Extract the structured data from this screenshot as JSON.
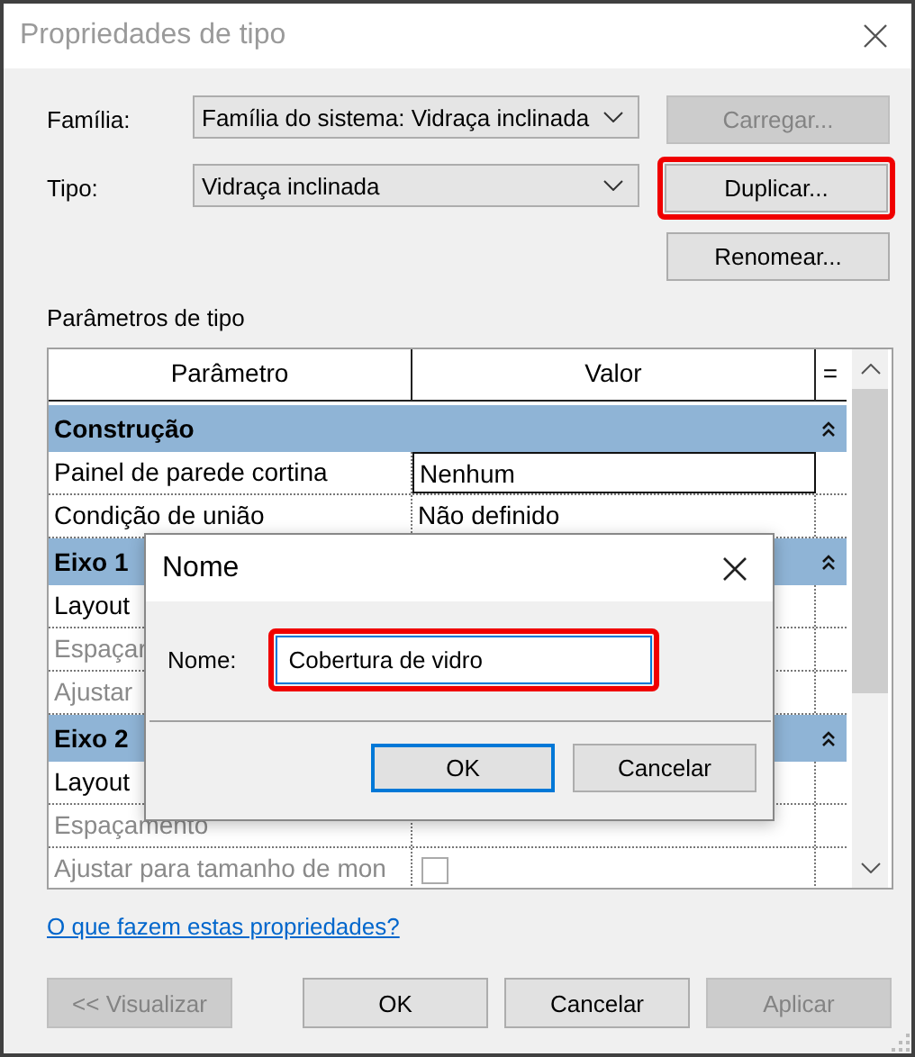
{
  "window": {
    "title": "Propriedades de tipo"
  },
  "selectors": [
    {
      "label": "Família:",
      "value": "Família do sistema: Vidraça inclinada"
    },
    {
      "label": "Tipo:",
      "value": "Vidraça inclinada"
    }
  ],
  "side_buttons": [
    {
      "label": "Carregar...",
      "disabled": true,
      "highlighted": false
    },
    {
      "label": "Duplicar...",
      "disabled": false,
      "highlighted": true
    },
    {
      "label": "Renomear...",
      "disabled": false,
      "highlighted": false
    }
  ],
  "parameters": {
    "label": "Parâmetros de tipo",
    "columns": [
      "Parâmetro",
      "Valor",
      "="
    ],
    "groups": [
      {
        "name": "Construção",
        "expanded": true,
        "rows": [
          {
            "name": "Painel de parede cortina",
            "value": "Nenhum",
            "disabled": false,
            "selected": true
          },
          {
            "name": "Condição de união",
            "value": "Não definido",
            "disabled": false,
            "selected": false
          }
        ]
      },
      {
        "name": "Eixo 1",
        "expanded": true,
        "rows": [
          {
            "name": "Layout",
            "disabled": false,
            "selected": false
          },
          {
            "name": "Espaçar",
            "disabled": true,
            "selected": false
          },
          {
            "name": "Ajustar",
            "disabled": true,
            "selected": false
          }
        ]
      },
      {
        "name": "Eixo 2",
        "expanded": true,
        "rows": [
          {
            "name": "Layout",
            "disabled": false,
            "selected": false
          },
          {
            "name": "Espaçamento",
            "disabled": true,
            "selected": false
          },
          {
            "name": "Ajustar para tamanho de mon",
            "kind": "checkbox",
            "checked": false,
            "disabled": true,
            "selected": false
          }
        ]
      }
    ]
  },
  "help_link": "O que fazem estas propriedades?",
  "buttons": [
    {
      "label": "<< Visualizar",
      "disabled": true
    },
    {
      "label": "OK",
      "disabled": false
    },
    {
      "label": "Cancelar",
      "disabled": false
    },
    {
      "label": "Aplicar",
      "disabled": true
    }
  ],
  "name_dialog": {
    "title": "Nome",
    "field_label": "Nome:",
    "value": "Cobertura de vidro",
    "highlighted": true,
    "buttons": [
      {
        "label": "OK",
        "default": true
      },
      {
        "label": "Cancelar",
        "default": false
      }
    ]
  }
}
